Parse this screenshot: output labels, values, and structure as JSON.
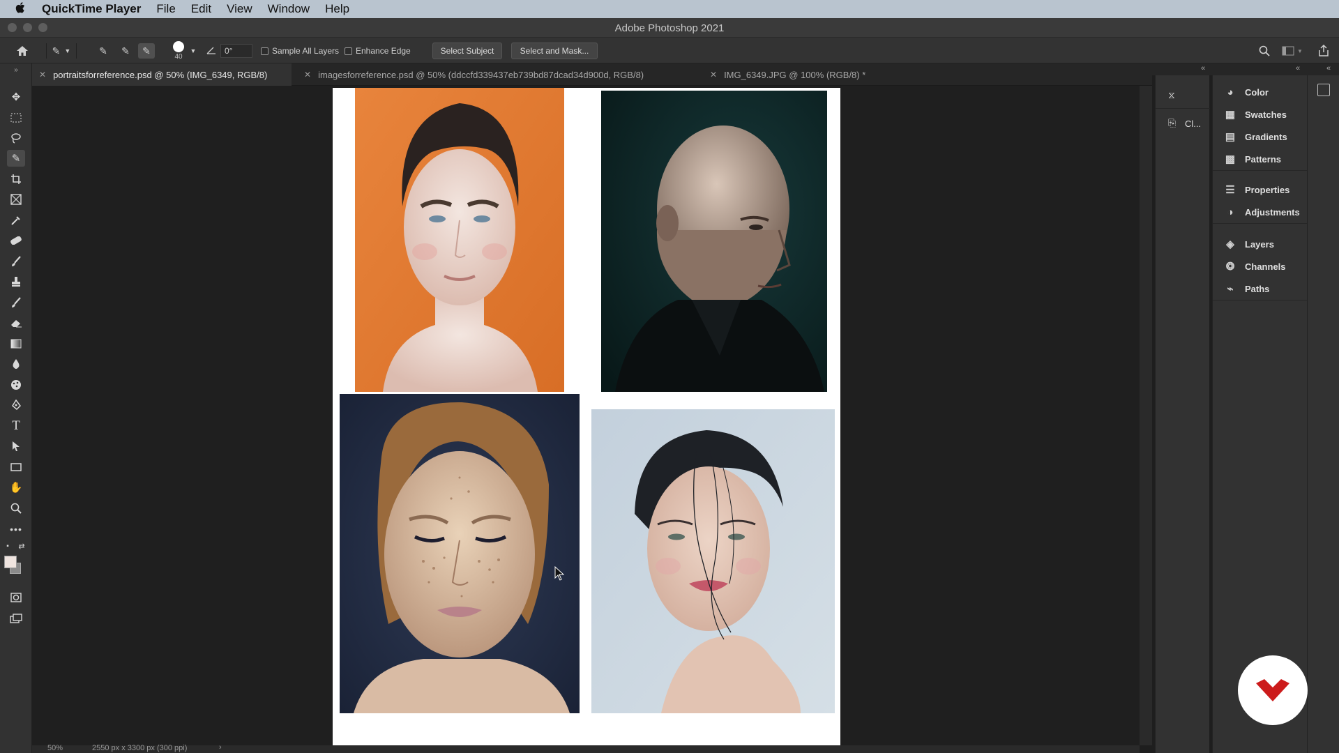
{
  "menubar": {
    "app_name": "QuickTime Player",
    "items": [
      "File",
      "Edit",
      "View",
      "Window",
      "Help"
    ]
  },
  "window": {
    "title": "Adobe Photoshop 2021"
  },
  "options": {
    "brush_size": "40",
    "angle": "0°",
    "sample_all_layers": "Sample All Layers",
    "enhance_edge": "Enhance Edge",
    "select_subject": "Select Subject",
    "select_and_mask": "Select and Mask..."
  },
  "tabs": [
    {
      "label": "portraitsforreference.psd @ 50% (IMG_6349, RGB/8)",
      "active": true
    },
    {
      "label": "imagesforreference.psd @ 50% (ddccfd339437eb739bd87dcad34d900d, RGB/8)",
      "active": false
    },
    {
      "label": "IMG_6349.JPG @ 100% (RGB/8) *",
      "active": false
    }
  ],
  "status": {
    "zoom": "50%",
    "doc_size": "2550 px x 3300 px (300 ppi)"
  },
  "iconpanel": {
    "items": [
      {
        "icon": "history-icon",
        "label": ""
      },
      {
        "icon": "clone-source-icon",
        "label": "Cl..."
      }
    ]
  },
  "panels": {
    "group1": [
      "Color",
      "Swatches",
      "Gradients",
      "Patterns"
    ],
    "group2": [
      "Properties",
      "Adjustments"
    ],
    "group3": [
      "Layers",
      "Channels",
      "Paths"
    ]
  },
  "colors": {
    "accent_logo": "#cc1b1b",
    "photo1_bg": "#e8813a",
    "photo2_bg": "#0f2a2b",
    "photo3_bg": "#26324a",
    "photo4_bg": "#c5d3dd"
  }
}
